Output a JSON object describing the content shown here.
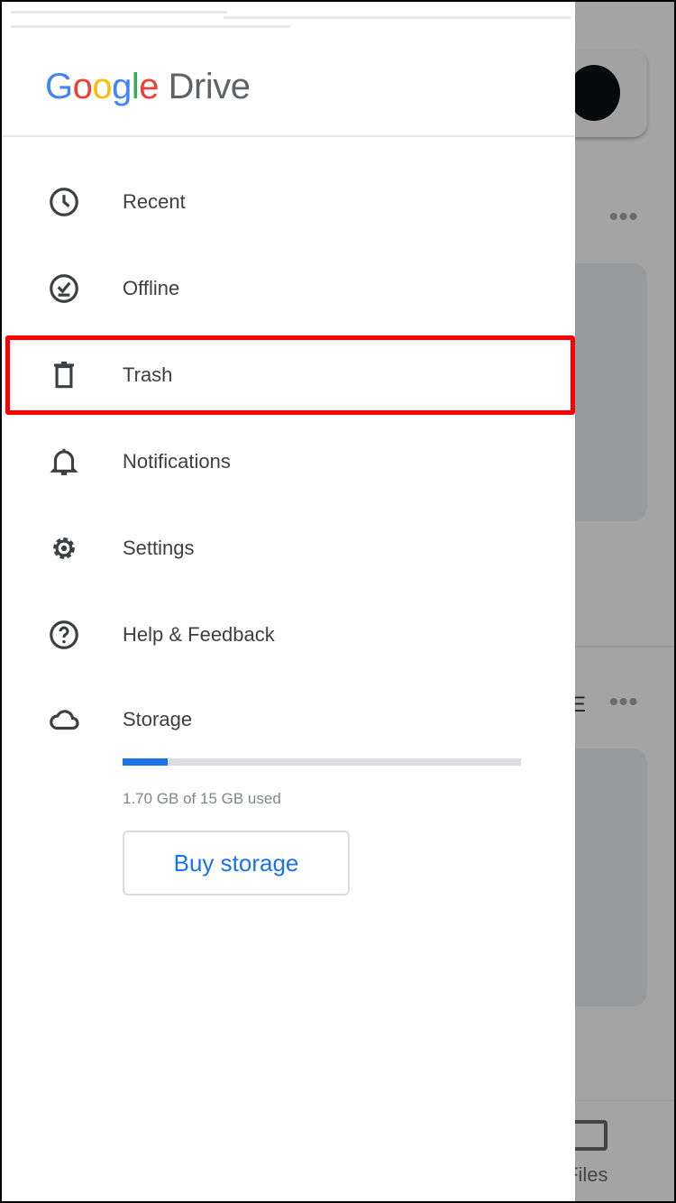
{
  "header": {
    "logo_google": "Google",
    "logo_drive": "Drive"
  },
  "menu": [
    {
      "label": "Recent",
      "icon": "clock-icon"
    },
    {
      "label": "Offline",
      "icon": "offline-check-icon"
    },
    {
      "label": "Trash",
      "icon": "trash-icon",
      "highlighted": true
    },
    {
      "label": "Notifications",
      "icon": "bell-icon"
    },
    {
      "label": "Settings",
      "icon": "gear-icon"
    },
    {
      "label": "Help & Feedback",
      "icon": "help-icon"
    },
    {
      "label": "Storage",
      "icon": "cloud-icon"
    }
  ],
  "storage": {
    "used_fraction": 0.113,
    "usage_text": "1.70 GB of 15 GB used",
    "buy_label": "Buy storage"
  },
  "background": {
    "files_tab": "Files",
    "partial_letter": "E"
  },
  "colors": {
    "accent": "#1a73e8",
    "highlight": "#ff0000"
  }
}
